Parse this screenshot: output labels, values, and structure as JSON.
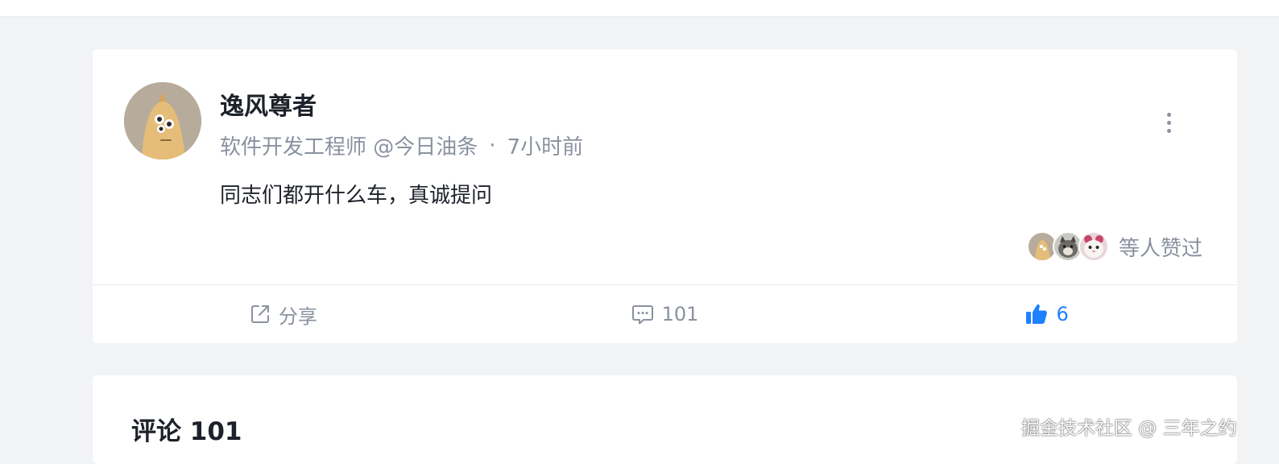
{
  "post": {
    "author_name": "逸风尊者",
    "author_title": "软件开发工程师 @今日油条",
    "meta_separator": "·",
    "post_time": "7小时前",
    "content": "同志们都开什么车，真诚提问",
    "likers_text": "等人赞过",
    "likers": [
      "avatar-1",
      "avatar-2",
      "avatar-3"
    ]
  },
  "actions": {
    "share_label": "分享",
    "comment_count": "101",
    "like_count": "6"
  },
  "comments": {
    "title": "评论 101"
  },
  "watermark": "掘金技术社区 @ 三年之约",
  "colors": {
    "accent": "#1e80ff",
    "text_primary": "#1d2129",
    "text_secondary": "#8a919f",
    "page_bg": "#f2f3f5"
  },
  "icons": {
    "more": "vertical-dots-icon",
    "share": "share-icon",
    "comment": "comment-icon",
    "like": "thumbs-up-icon"
  }
}
